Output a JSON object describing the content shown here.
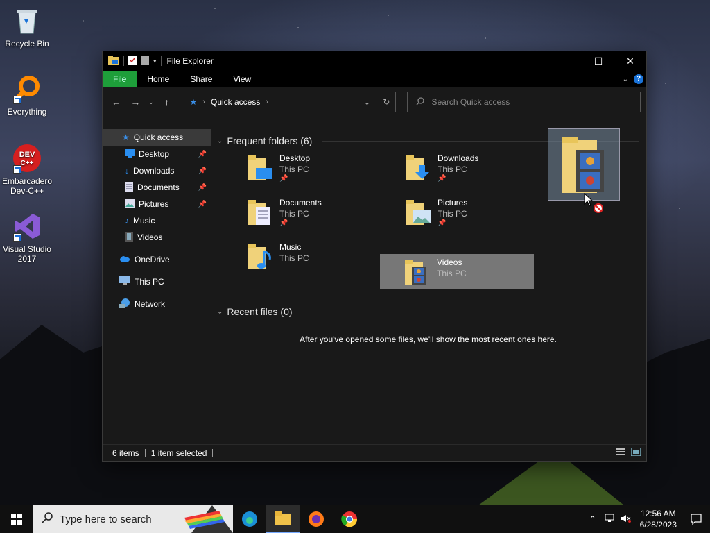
{
  "desktop": {
    "icons": [
      {
        "label": "Recycle Bin"
      },
      {
        "label": "Everything"
      },
      {
        "label": "Embarcadero Dev-C++"
      },
      {
        "label": "Visual Studio 2017"
      }
    ]
  },
  "window": {
    "title": "File Explorer",
    "controls": {
      "minimize": "—",
      "maximize": "☐",
      "close": "✕"
    }
  },
  "ribbon": {
    "tabs": [
      "File",
      "Home",
      "Share",
      "View"
    ],
    "help": "?"
  },
  "navbar": {
    "address_crumb": "Quick access",
    "search_placeholder": "Search Quick access"
  },
  "sidebar": {
    "items": [
      {
        "label": "Quick access"
      },
      {
        "label": "Desktop"
      },
      {
        "label": "Downloads"
      },
      {
        "label": "Documents"
      },
      {
        "label": "Pictures"
      },
      {
        "label": "Music"
      },
      {
        "label": "Videos"
      },
      {
        "label": "OneDrive"
      },
      {
        "label": "This PC"
      },
      {
        "label": "Network"
      }
    ]
  },
  "main": {
    "frequent_header": "Frequent folders (6)",
    "folders": [
      {
        "name": "Desktop",
        "location": "This PC"
      },
      {
        "name": "Downloads",
        "location": "This PC"
      },
      {
        "name": "Documents",
        "location": "This PC"
      },
      {
        "name": "Pictures",
        "location": "This PC"
      },
      {
        "name": "Music",
        "location": "This PC"
      },
      {
        "name": "Videos",
        "location": "This PC"
      }
    ],
    "recent_header": "Recent files (0)",
    "recent_empty_message": "After you've opened some files, we'll show the most recent ones here."
  },
  "statusbar": {
    "items_count": "6 items",
    "selected_count": "1 item selected"
  },
  "taskbar": {
    "search_placeholder": "Type here to search",
    "time": "12:56 AM",
    "date": "6/28/2023"
  },
  "colors": {
    "file_tab": "#1e9e3a",
    "accent": "#1a73d9",
    "selection": "#777777"
  }
}
